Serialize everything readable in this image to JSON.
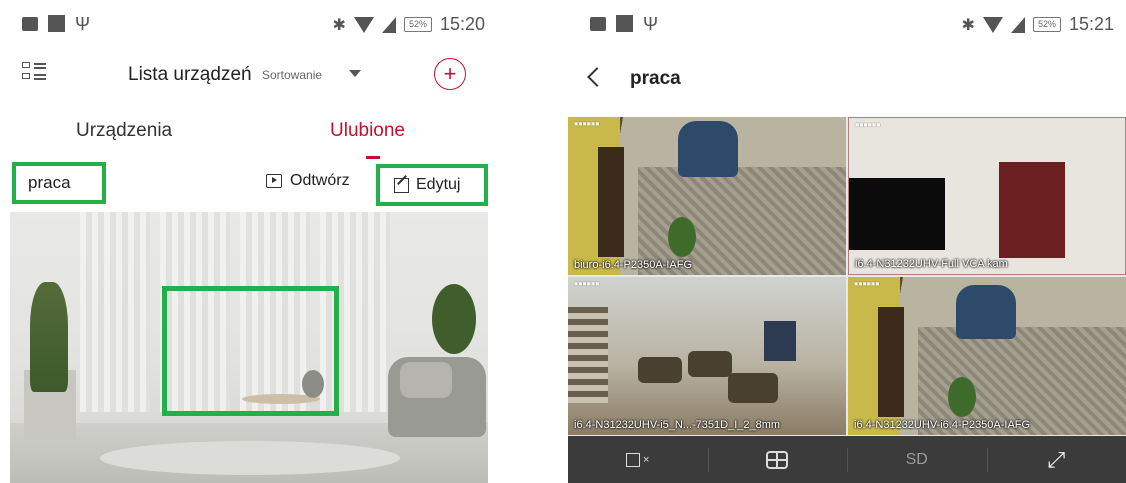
{
  "left": {
    "status": {
      "battery": "52%",
      "time": "15:20"
    },
    "header": {
      "title": "Lista urządzeń",
      "sort_label": "Sortowanie"
    },
    "tabs": [
      {
        "label": "Urządzenia",
        "active": false
      },
      {
        "label": "Ulubione",
        "active": true
      }
    ],
    "group": {
      "name": "praca"
    },
    "actions": {
      "play_label": "Odtwórz",
      "edit_label": "Edytuj"
    }
  },
  "right": {
    "status": {
      "battery": "52%",
      "time": "15:21"
    },
    "title": "praca",
    "cameras": [
      {
        "label": "biuro-i6.4-P2350A-IAFG"
      },
      {
        "label": "i6.4-N31232UHV-Full VCA kam"
      },
      {
        "label": "i6.4-N31232UHV-i5_N...-7351D_I_2_8mm"
      },
      {
        "label": "i6.4-N31232UHV-i6.4-P2350A-IAFG"
      }
    ],
    "toolbar": {
      "quality": "SD"
    }
  },
  "colors": {
    "accent": "#c8102e",
    "highlight": "#23b04a",
    "toolbar_bg": "#3b3b3b"
  }
}
